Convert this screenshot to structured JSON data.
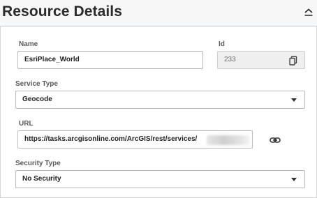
{
  "header": {
    "title": "Resource Details"
  },
  "fields": {
    "name": {
      "label": "Name",
      "value": "EsriPlace_World"
    },
    "id": {
      "label": "Id",
      "value": "233"
    },
    "service_type": {
      "label": "Service Type",
      "value": "Geocode"
    },
    "url": {
      "label": "URL",
      "value": "https://tasks.arcgisonline.com/ArcGIS/rest/services/"
    },
    "security_type": {
      "label": "Security Type",
      "value": "No Security"
    }
  },
  "icons": {
    "collapse": "chevron-up-icon",
    "copy": "copy-icon",
    "link": "link-icon",
    "dropdown": "caret-down-icon"
  },
  "colors": {
    "header_border": "#b9cfe3",
    "text": "#333333",
    "field_border": "#b8b8b8"
  }
}
